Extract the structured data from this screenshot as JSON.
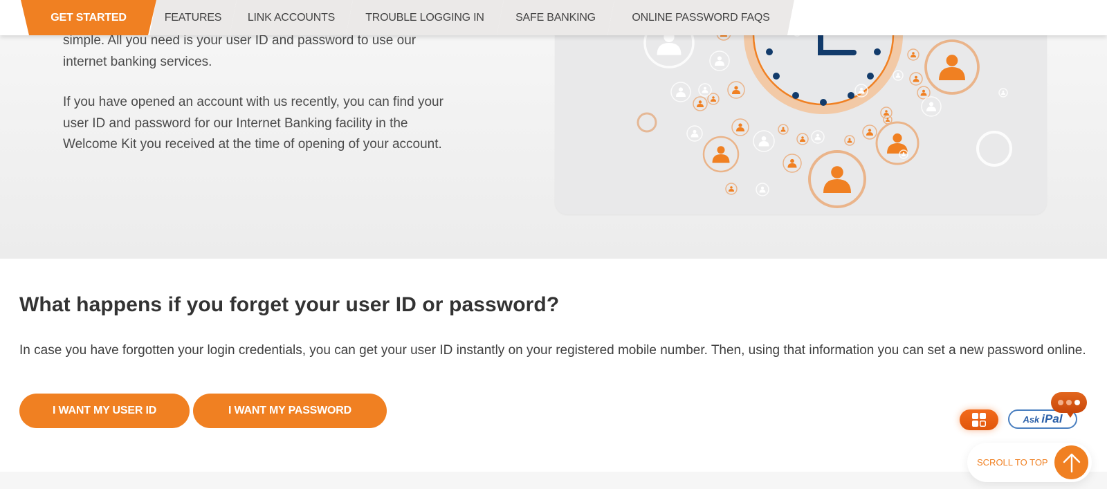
{
  "tabs": [
    {
      "label": "GET STARTED",
      "active": true
    },
    {
      "label": "FEATURES",
      "active": false
    },
    {
      "label": "LINK ACCOUNTS",
      "active": false
    },
    {
      "label": "TROUBLE LOGGING IN",
      "active": false
    },
    {
      "label": "SAFE BANKING",
      "active": false
    },
    {
      "label": "ONLINE PASSWORD FAQS",
      "active": false
    }
  ],
  "intro": {
    "paragraph_1": "simple. All you need is your user ID and password to use our internet banking services.",
    "paragraph_2": "If you have opened an account with us recently, you can find your user ID and password for our Internet Banking facility in the Welcome Kit you received at the time of opening of your account."
  },
  "illustration": {
    "icon": "clock-with-people-network-illustration"
  },
  "forgot": {
    "heading": "What happens if you forget your user ID or password?",
    "text": "In case you have forgotten your login credentials, you can get your user ID instantly on your registered mobile number. Then, using that information you can set a new password online.",
    "buttons": {
      "user_id": "I WANT MY USER ID",
      "password": "I WANT MY PASSWORD"
    }
  },
  "widgets": {
    "apps_icon": "grid-apps-icon",
    "ask_label": "Ask",
    "ipal_label": "iPal",
    "chat_icon": "chat-bubble-icon",
    "scroll_to_top": "SCROLL TO TOP",
    "scroll_icon": "arrow-up-icon"
  },
  "colors": {
    "brand_orange": "#f08022",
    "tab_inactive": "#ebe9e8",
    "clock_navy": "#123b6b",
    "ipal_blue": "#2a5fa8"
  }
}
